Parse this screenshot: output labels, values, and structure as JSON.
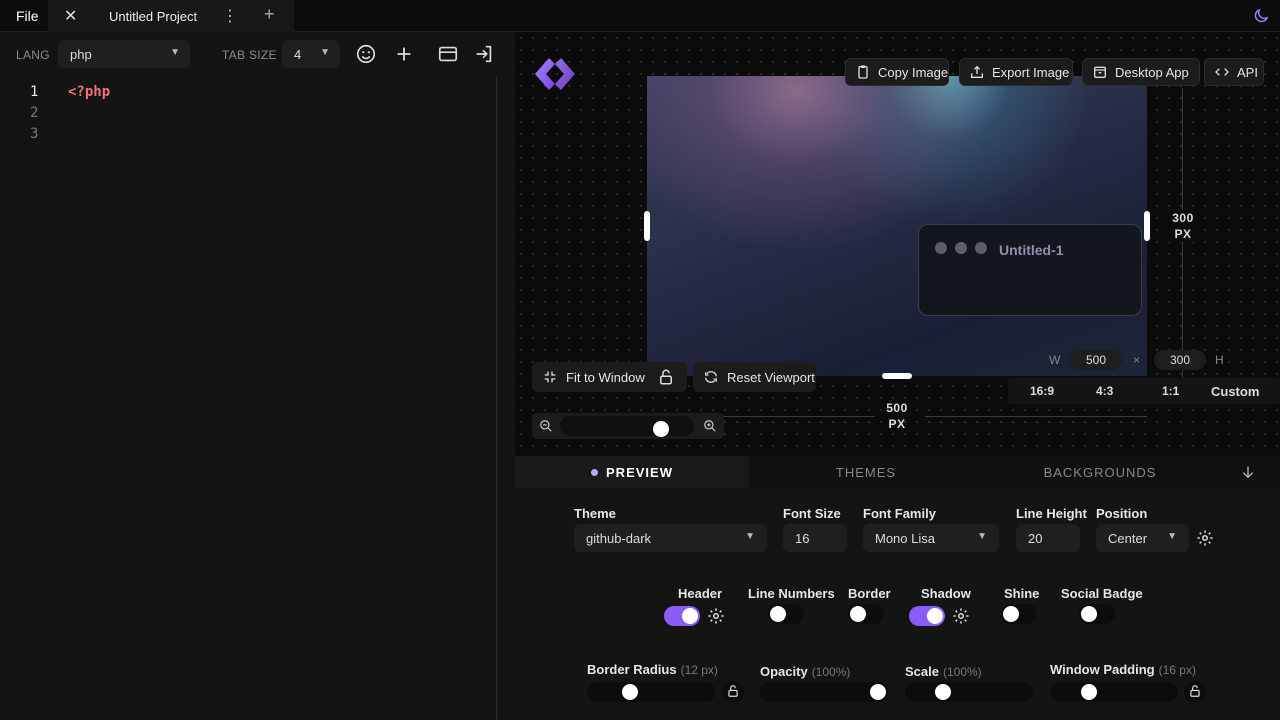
{
  "topbar": {
    "file_label": "File",
    "project_title": "Untitled Project"
  },
  "editor": {
    "lang_label": "LANG",
    "lang_value": "php",
    "tabsize_label": "TAB SIZE",
    "tabsize_value": "4",
    "line_numbers": [
      "1",
      "2",
      "3"
    ],
    "code_line_1": "<?php"
  },
  "canvas": {
    "copy_image": "Copy Image",
    "export_image": "Export Image",
    "desktop_app": "Desktop App",
    "api": "API",
    "window_title": "Untitled-1",
    "height_px_value": "300",
    "height_px_unit": "PX",
    "width_px_value": "500",
    "width_px_unit": "PX",
    "w_label": "W",
    "w_value": "500",
    "times": "×",
    "h_value": "300",
    "h_label": "H",
    "ratios": [
      "16:9",
      "4:3",
      "1:1",
      "Custom"
    ],
    "fit_to_window": "Fit to Window",
    "reset_viewport": "Reset Viewport",
    "zoom_level": 0.55
  },
  "tabs": {
    "preview": "PREVIEW",
    "themes": "THEMES",
    "backgrounds": "BACKGROUNDS"
  },
  "settings": {
    "theme_label": "Theme",
    "theme_value": "github-dark",
    "font_size_label": "Font Size",
    "font_size_value": "16",
    "font_family_label": "Font Family",
    "font_family_value": "Mono Lisa",
    "line_height_label": "Line Height",
    "line_height_value": "20",
    "position_label": "Position",
    "position_value": "Center",
    "toggles": {
      "header": {
        "label": "Header",
        "on": true
      },
      "line_numbers": {
        "label": "Line Numbers",
        "on": false
      },
      "border": {
        "label": "Border",
        "on": false
      },
      "shadow": {
        "label": "Shadow",
        "on": true
      },
      "shine": {
        "label": "Shine",
        "on": false
      },
      "social_badge": {
        "label": "Social Badge",
        "on": false
      }
    },
    "border_radius_label": "Border Radius",
    "border_radius_sub": "(12 px)",
    "opacity_label": "Opacity",
    "opacity_sub": "(100%)",
    "scale_label": "Scale",
    "scale_sub": "(100%)",
    "window_padding_label": "Window Padding",
    "window_padding_sub": "(16 px)"
  },
  "colors": {
    "accent": "#8b5cf6",
    "code_keyword": "#f07178"
  }
}
